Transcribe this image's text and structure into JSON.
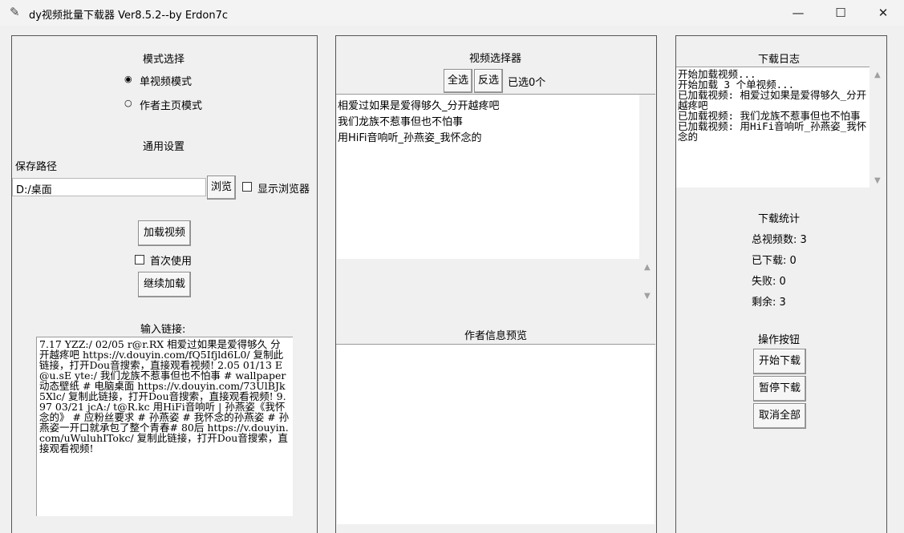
{
  "window": {
    "title": "dy视频批量下载器 Ver8.5.2--by Erdon7c",
    "minimize": "—",
    "maximize": "☐",
    "close": "✕"
  },
  "left": {
    "mode_title": "模式选择",
    "mode_single": "单视频模式",
    "mode_author": "作者主页模式",
    "general_title": "通用设置",
    "save_path_label": "保存路径",
    "save_path_value": "D:/桌面",
    "browse": "浏览",
    "show_browser": "显示浏览器",
    "load_videos": "加载视频",
    "first_use": "首次使用",
    "continue_load": "继续加载",
    "input_label": "输入链接:",
    "input_text": "7.17 YZZ:/ 02/05 r@r.RX 相爱过如果是爱得够久 分开越疼吧  https://v.douyin.com/fQ5Ifjld6L0/ 复制此链接，打开Dou音搜索，直接观看视频! 2.05 01/13 E@u.sE yte:/ 我们龙族不惹事但也不怕事 # wallpaper动态壁纸 # 电脑桌面  https://v.douyin.com/73UlBJk5Xlc/ 复制此链接，打开Dou音搜索，直接观看视频! 9.97 03/21 jcA:/ t@R.kc 用HiFi音响听 | 孙燕姿《我怀念的》 # 应粉丝要求 # 孙燕姿 # 我怀念的孙燕姿 # 孙燕姿一开口就承包了整个青春# 80后  https://v.douyin.com/uWuluhITokc/ 复制此链接，打开Dou音搜索，直接观看视频!"
  },
  "middle": {
    "selector_title": "视频选择器",
    "select_all": "全选",
    "invert": "反选",
    "selected_count": "已选0个",
    "videos": [
      "相爱过如果是爱得够久_分开越疼吧",
      "我们龙族不惹事但也不怕事",
      "用HiFi音响听_孙燕姿_我怀念的"
    ],
    "author_title": "作者信息预览"
  },
  "right": {
    "log_title": "下载日志",
    "log_text": "开始加载视频...\n开始加载 3 个单视频...\n已加载视频: 相爱过如果是爱得够久_分开越疼吧\n已加载视频: 我们龙族不惹事但也不怕事\n已加载视频: 用HiFi音响听_孙燕姿_我怀念的",
    "stats_title": "下载统计",
    "total": "总视频数: 3",
    "downloaded": "已下载: 0",
    "failed": "失败: 0",
    "remaining": "剩余: 3",
    "ops_title": "操作按钮",
    "start": "开始下载",
    "pause": "暂停下载",
    "cancel_all": "取消全部"
  }
}
